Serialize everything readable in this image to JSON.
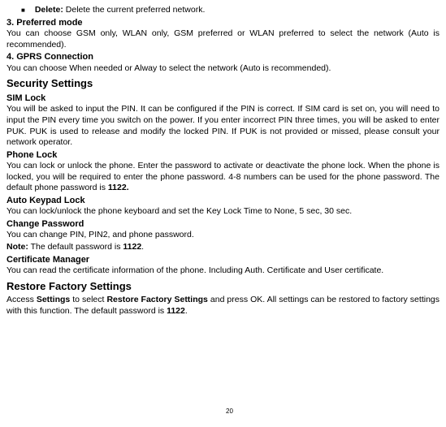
{
  "bullet": {
    "label": "Delete:",
    "text": " Delete the current preferred network."
  },
  "sec3": {
    "heading": "3. Preferred mode",
    "body": "You can choose GSM only, WLAN only, GSM preferred or WLAN preferred to select the network (Auto is recommended)."
  },
  "sec4": {
    "heading": "4. GPRS Connection",
    "body": "You can choose When needed or Alway to select the network (Auto is recommended)."
  },
  "security": {
    "heading": "Security Settings",
    "sim": {
      "heading": "SIM Lock",
      "body": "You will be asked to input the PIN. It can be configured if the PIN is correct. If SIM card is set on, you will need to input the PIN every time you switch on the power. If you enter incorrect PIN three times, you will be asked to enter PUK. PUK is used to release and modify the locked PIN. If PUK is not provided or missed, please consult your network operator."
    },
    "phone": {
      "heading": "Phone Lock",
      "body_pre": "You can lock or unlock the phone. Enter the password to activate or deactivate the phone lock. When the phone is locked, you will be required to enter the phone password. 4-8 numbers can be used for the phone password. The default phone password is ",
      "body_bold": "1122."
    },
    "keypad": {
      "heading": "Auto Keypad Lock",
      "body": "You can lock/unlock the phone keyboard and set the Key Lock Time to None, 5 sec, 30 sec."
    },
    "change": {
      "heading": "Change Password",
      "body": "You can change PIN, PIN2, and phone password.",
      "note_label": "Note:",
      "note_text_pre": " The default password is ",
      "note_bold": "1122",
      "note_text_post": "."
    },
    "cert": {
      "heading": "Certificate Manager",
      "body": "You can read the certificate information of the phone. Including Auth. Certificate and User certificate."
    }
  },
  "restore": {
    "heading": "Restore Factory Settings",
    "pre": "Access ",
    "b1": "Settings",
    "mid1": " to select ",
    "b2": "Restore Factory Settings",
    "mid2": " and press OK. All settings can be restored to factory settings with this function. The default password is ",
    "b3": "1122",
    "post": "."
  },
  "page": "20"
}
